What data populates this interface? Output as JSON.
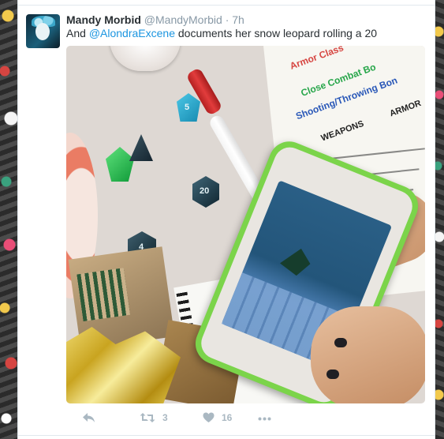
{
  "tweet": {
    "name": "Mandy Morbid",
    "handle": "@MandyMorbid",
    "separator": "·",
    "time": "7h",
    "text_before": "And ",
    "mention": "@AlondraExcene",
    "text_after": " documents her snow leopard rolling a 20"
  },
  "photo_text": {
    "sheet_line_1": "Armor Class",
    "sheet_line_2": "Close Combat Bo",
    "sheet_line_3": "Shooting/Throwing Bon",
    "sheet_weapons": "WEAPONS",
    "sheet_armor": "ARMOR",
    "die_20": "20",
    "die_4": "4",
    "die_5": "5"
  },
  "actions": {
    "retweet_count": "3",
    "like_count": "16"
  },
  "colors": {
    "link": "#1b95e0",
    "name": "#292f33",
    "meta": "#8899a6",
    "action": "#aab8c2"
  }
}
